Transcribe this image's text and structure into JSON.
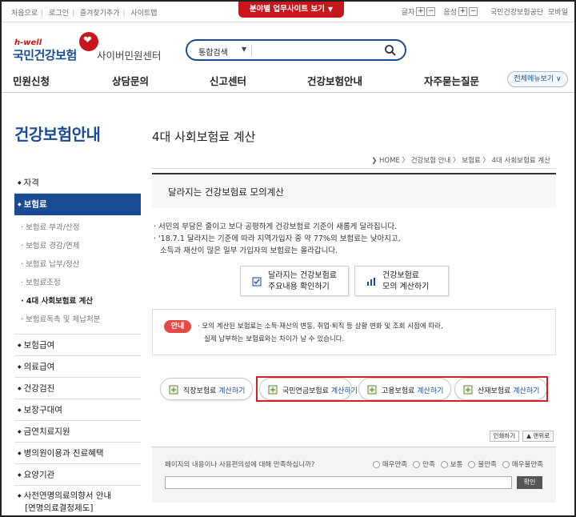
{
  "topbar": {
    "links": [
      "처음으로",
      "로그인",
      "즐겨찾기추가",
      "사이트맵"
    ],
    "red_tab": "분야별 업무사이트 보기",
    "red_tab_arrow": "▼",
    "font_label": "글자",
    "sound_label": "음성",
    "plus": "+",
    "minus": "−",
    "org_link": "국민건강보험공단",
    "mobile_link": "모바일"
  },
  "header": {
    "brand_tag": "h-well",
    "brand_name": "국민건강보험",
    "brand_sub": "사이버민원센터"
  },
  "search": {
    "category": "통합검색",
    "category_arrow": "▼",
    "placeholder": "",
    "value": ""
  },
  "gnb": {
    "items": [
      "민원신청",
      "상담문의",
      "신고센터",
      "건강보험안내",
      "자주묻는질문"
    ],
    "all_menu": "전체메뉴보기 ∨"
  },
  "sidebar": {
    "title": "건강보험안내",
    "items": [
      {
        "label": "자격"
      },
      {
        "label": "보험료"
      },
      {
        "label": "보험급여"
      },
      {
        "label": "의료급여"
      },
      {
        "label": "건강검진"
      },
      {
        "label": "보장구대여"
      },
      {
        "label": "금연치료지원"
      },
      {
        "label": "병의원이용과 진료혜택"
      },
      {
        "label": "요양기관"
      },
      {
        "label": "사전연명의료의향서 안내",
        "label2": "[연명의료결정제도]"
      }
    ],
    "subitems": [
      "보험료 부과/산정",
      "보험료 경감/면제",
      "보험료 납부/정산",
      "보험료조정",
      "4대 사회보험료 계산",
      "보험료독촉 및 체납처분"
    ],
    "bullet": "◆",
    "sub_bullet": "·"
  },
  "main": {
    "title": "4대 사회보험료 계산",
    "breadcrumb": "HOME 〉 건강보험 안내 〉 보험료 〉 4대 사회보험료 계산",
    "breadcrumb_arrow": "❯",
    "sim_title": "달라지는 건강보험료 모의계산",
    "bullets": [
      "· 서민의 부담은 줄이고 보다 공평하게 건강보험료 기준이 새롭게 달라집니다.",
      "· '18.7.1 달라지는 기준에 따라 지역가입자 중 약 77%의 보험료는 낮아지고,",
      "소득과 재산이 많은 일부 가입자의 보험료는 올라갑니다."
    ],
    "btn_changes": {
      "line1": "달라지는 건강보험료",
      "line2": "주요내용 확인하기"
    },
    "btn_calc": {
      "line1": "건강보험료",
      "line2": "모의 계산하기"
    },
    "notice_tag": "안내",
    "notice_lines": [
      "· 모의 계산된 보험료는 소득·재산의 변동, 취업·퇴직 등 상황 변화 및 조회 시점에 따라,",
      "실제 납부하는 보험료와는 차이가 날 수 있습니다."
    ],
    "calc_buttons": [
      {
        "name": "직장보험료",
        "action": " 계산하기"
      },
      {
        "name": "국민연금보험료",
        "action": " 계산하기"
      },
      {
        "name": "고용보험료",
        "action": " 계산하기"
      },
      {
        "name": "산재보험료",
        "action": " 계산하기"
      }
    ],
    "print_label": "인쇄하기",
    "top_label": "▲ 맨위로",
    "survey": {
      "question": "페이지의 내용이나 사용편의성에 대해 만족하십니까?",
      "options": [
        "매우만족",
        "만족",
        "보통",
        "불만족",
        "매우불만족"
      ],
      "submit": "확인",
      "input_value": ""
    }
  },
  "colors": {
    "brand_blue": "#1a4b95",
    "brand_red": "#c8161d",
    "highlight_red": "#d32027"
  }
}
